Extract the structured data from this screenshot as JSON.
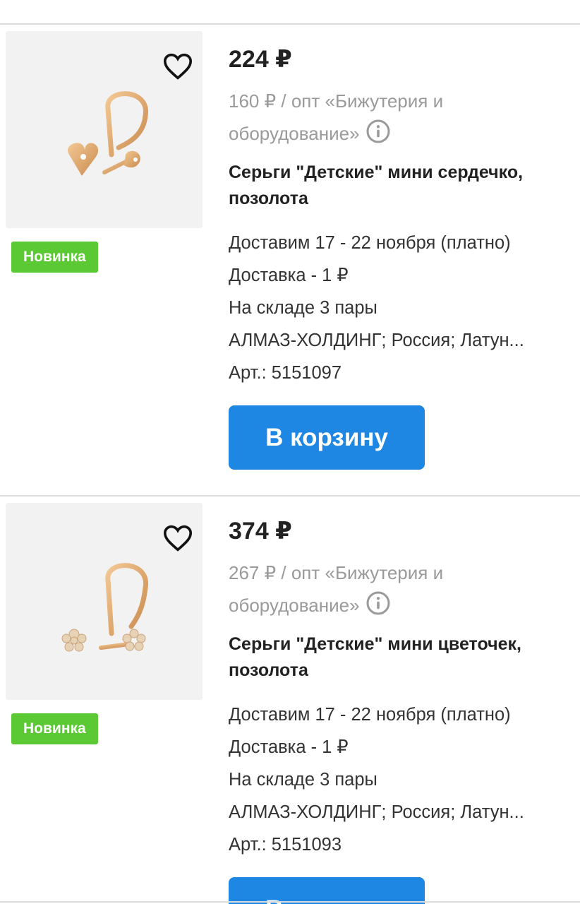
{
  "colors": {
    "accent": "#1e86e3",
    "badge": "#5ac933",
    "muted": "#9a9a9a"
  },
  "products": [
    {
      "price": "224 ₽",
      "opt": "160 ₽ / опт «Бижутерия и оборудование»",
      "title": "Серьги \"Детские\" мини сердечко, позолота",
      "badge": "Новинка",
      "details": [
        "Доставим 17 - 22 ноября (платно)",
        "Доставка - 1 ₽",
        "На складе 3 пары",
        "АЛМАЗ-ХОЛДИНГ; Россия; Латун...",
        "Арт.: 5151097"
      ],
      "cart_label": "В корзину",
      "favorite_icon": "heart-outline-icon",
      "info_icon": "info-circle-icon"
    },
    {
      "price": "374 ₽",
      "opt": "267 ₽ / опт «Бижутерия и оборудование»",
      "title": "Серьги \"Детские\" мини цветочек, позолота",
      "badge": "Новинка",
      "details": [
        "Доставим 17 - 22 ноября (платно)",
        "Доставка - 1 ₽",
        "На складе 3 пары",
        "АЛМАЗ-ХОЛДИНГ; Россия; Латун...",
        "Арт.: 5151093"
      ],
      "cart_label": "В корзину",
      "favorite_icon": "heart-outline-icon",
      "info_icon": "info-circle-icon"
    }
  ]
}
